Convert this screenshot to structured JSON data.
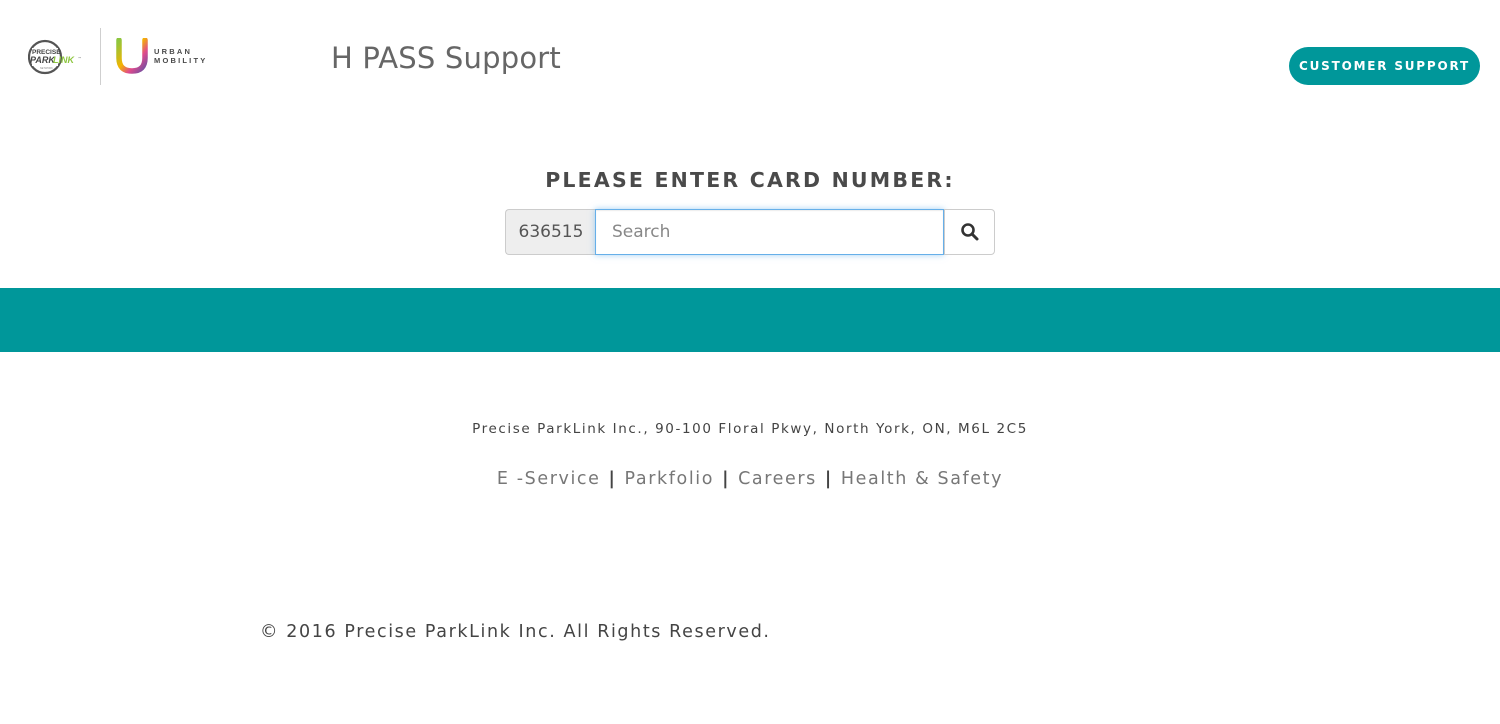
{
  "header": {
    "logo_precise_alt": "Precise ParkLink",
    "logo_urban_line1": "URBAN",
    "logo_urban_line2": "MOBILITY",
    "title": "H PASS Support",
    "support_button_label": "CUSTOMER SUPPORT"
  },
  "search": {
    "label": "PLEASE ENTER CARD NUMBER:",
    "prefix": "636515",
    "placeholder": "Search",
    "value": "",
    "button_icon": "search-icon"
  },
  "footer": {
    "address": "Precise ParkLink Inc., 90-100 Floral Pkwy, North York, ON, M6L 2C5",
    "links": [
      "E -Service",
      "Parkfolio",
      "Careers",
      "Health & Safety"
    ],
    "separator": "|",
    "copyright": "© 2016 Precise ParkLink Inc. All Rights Reserved."
  },
  "colors": {
    "accent": "#00979a",
    "focus_border": "#66afe9",
    "logo_green": "#8dc63f",
    "text_dark": "#4a4a4a"
  }
}
